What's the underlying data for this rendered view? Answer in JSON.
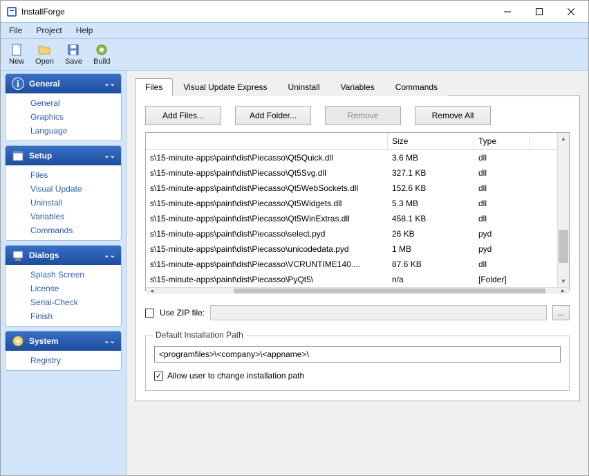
{
  "window": {
    "title": "InstallForge"
  },
  "menu": {
    "file": "File",
    "project": "Project",
    "help": "Help"
  },
  "toolbar": {
    "new": "New",
    "open": "Open",
    "save": "Save",
    "build": "Build"
  },
  "sidebar": {
    "panels": [
      {
        "title": "General",
        "items": [
          "General",
          "Graphics",
          "Language"
        ]
      },
      {
        "title": "Setup",
        "items": [
          "Files",
          "Visual Update",
          "Uninstall",
          "Variables",
          "Commands"
        ]
      },
      {
        "title": "Dialogs",
        "items": [
          "Splash Screen",
          "License",
          "Serial-Check",
          "Finish"
        ]
      },
      {
        "title": "System",
        "items": [
          "Registry"
        ]
      }
    ]
  },
  "tabs": {
    "files": "Files",
    "visual_update": "Visual Update Express",
    "uninstall": "Uninstall",
    "variables": "Variables",
    "commands": "Commands"
  },
  "buttons": {
    "add_files": "Add Files...",
    "add_folder": "Add Folder...",
    "remove": "Remove",
    "remove_all": "Remove All"
  },
  "file_headers": {
    "name": "",
    "size": "Size",
    "type": "Type"
  },
  "files": [
    {
      "name": "s\\15-minute-apps\\paint\\dist\\Piecasso\\Qt5Quick.dll",
      "size": "3.6 MB",
      "type": "dll"
    },
    {
      "name": "s\\15-minute-apps\\paint\\dist\\Piecasso\\Qt5Svg.dll",
      "size": "327.1 KB",
      "type": "dll"
    },
    {
      "name": "s\\15-minute-apps\\paint\\dist\\Piecasso\\Qt5WebSockets.dll",
      "size": "152.6 KB",
      "type": "dll"
    },
    {
      "name": "s\\15-minute-apps\\paint\\dist\\Piecasso\\Qt5Widgets.dll",
      "size": "5.3 MB",
      "type": "dll"
    },
    {
      "name": "s\\15-minute-apps\\paint\\dist\\Piecasso\\Qt5WinExtras.dll",
      "size": "458.1 KB",
      "type": "dll"
    },
    {
      "name": "s\\15-minute-apps\\paint\\dist\\Piecasso\\select.pyd",
      "size": "26 KB",
      "type": "pyd"
    },
    {
      "name": "s\\15-minute-apps\\paint\\dist\\Piecasso\\unicodedata.pyd",
      "size": "1 MB",
      "type": "pyd"
    },
    {
      "name": "s\\15-minute-apps\\paint\\dist\\Piecasso\\VCRUNTIME140....",
      "size": "87.6 KB",
      "type": "dll"
    },
    {
      "name": "s\\15-minute-apps\\paint\\dist\\Piecasso\\PyQt5\\",
      "size": "n/a",
      "type": "[Folder]"
    }
  ],
  "zip": {
    "label": "Use ZIP file:",
    "browse": "..."
  },
  "install_path": {
    "legend": "Default Installation Path",
    "value": "<programfiles>\\<company>\\<appname>\\",
    "allow_change": "Allow user to change installation path"
  }
}
